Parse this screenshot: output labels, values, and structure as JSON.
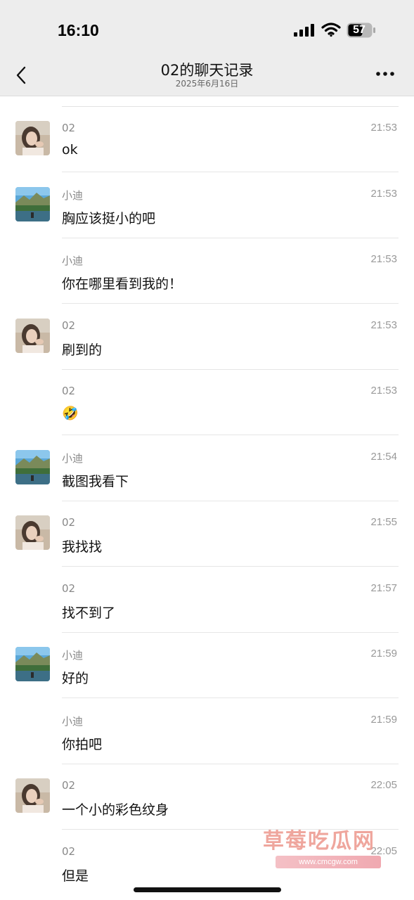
{
  "status_bar": {
    "time": "16:10",
    "battery": "57",
    "icons": [
      "signal-icon",
      "wifi-icon",
      "battery-icon"
    ]
  },
  "header": {
    "title": "02的聊天记录",
    "subtitle": "2025年6月16日",
    "back_icon": "chevron-left-icon",
    "more_icon": "more-dots-icon"
  },
  "messages": [
    {
      "sender": "02",
      "time": "21:53",
      "text": "ok",
      "avatar": "girl"
    },
    {
      "sender": "小迪",
      "time": "21:53",
      "text": "胸应该挺小的吧",
      "avatar": "landscape"
    },
    {
      "sender": "小迪",
      "time": "21:53",
      "text": "你在哪里看到我的！",
      "avatar": ""
    },
    {
      "sender": "02",
      "time": "21:53",
      "text": "刷到的",
      "avatar": "girl"
    },
    {
      "sender": "02",
      "time": "21:53",
      "text": "🤣",
      "avatar": ""
    },
    {
      "sender": "小迪",
      "time": "21:54",
      "text": "截图我看下",
      "avatar": "landscape"
    },
    {
      "sender": "02",
      "time": "21:55",
      "text": "我找找",
      "avatar": "girl"
    },
    {
      "sender": "02",
      "time": "21:57",
      "text": "找不到了",
      "avatar": ""
    },
    {
      "sender": "小迪",
      "time": "21:59",
      "text": "好的",
      "avatar": "landscape"
    },
    {
      "sender": "小迪",
      "time": "21:59",
      "text": "你拍吧",
      "avatar": ""
    },
    {
      "sender": "02",
      "time": "22:05",
      "text": "一个小的彩色纹身",
      "avatar": "girl"
    },
    {
      "sender": "02",
      "time": "22:05",
      "text": "但是",
      "avatar": ""
    }
  ],
  "watermark": {
    "title": "草莓吃瓜网",
    "url": "www.cmcgw.com"
  },
  "colors": {
    "header_bg": "#ededed",
    "divider": "#e6e6e6",
    "meta_text": "#999999"
  }
}
